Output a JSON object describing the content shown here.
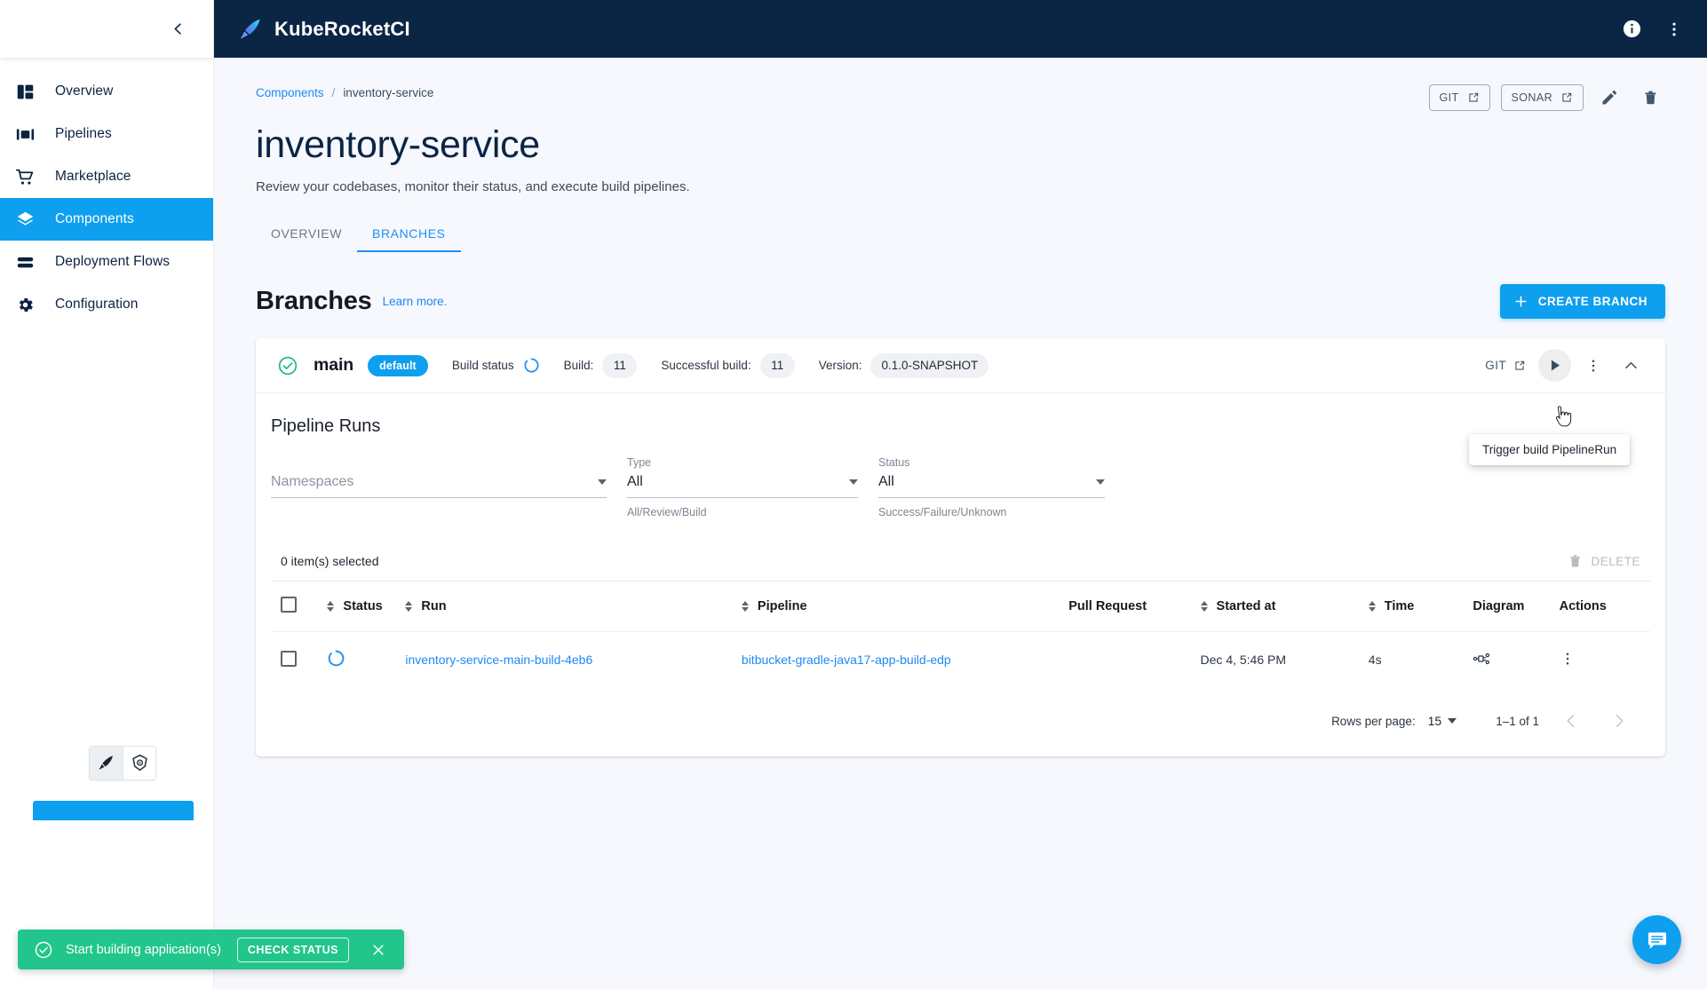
{
  "app": {
    "brand": "KubeRocketCI",
    "brand_logo_icon": "rocket-feather-icon",
    "info_icon": "info-icon",
    "overflow_icon": "vertical-dots-icon",
    "accent_color": "#0e9fef",
    "topbar_color": "#0b2545",
    "link_color": "#1e88f5",
    "success_color": "#22c58b"
  },
  "sidebar": {
    "collapse_icon": "chevron-left-icon",
    "items": [
      {
        "label": "Overview",
        "icon": "dashboard-icon",
        "active": false
      },
      {
        "label": "Pipelines",
        "icon": "pipelines-icon",
        "active": false
      },
      {
        "label": "Marketplace",
        "icon": "cart-icon",
        "active": false
      },
      {
        "label": "Components",
        "icon": "layers-icon",
        "active": true
      },
      {
        "label": "Deployment Flows",
        "icon": "stacked-bars-icon",
        "active": false
      },
      {
        "label": "Configuration",
        "icon": "gear-icon",
        "active": false
      }
    ],
    "fab_buttons": [
      {
        "icon": "rocket-feather-icon",
        "selected": true
      },
      {
        "icon": "kubernetes-icon",
        "selected": false
      }
    ]
  },
  "breadcrumb": {
    "parent": "Components",
    "separator": "/",
    "current": "inventory-service"
  },
  "header_actions": {
    "git_label": "GIT",
    "sonar_label": "SONAR",
    "external_link_icon": "external-link-icon",
    "edit_icon": "pencil-icon",
    "delete_icon": "trash-icon"
  },
  "page": {
    "title": "inventory-service",
    "subtitle": "Review your codebases, monitor their status, and execute build pipelines."
  },
  "tabs": [
    {
      "label": "OVERVIEW",
      "active": false
    },
    {
      "label": "BRANCHES",
      "active": true
    }
  ],
  "branches_section": {
    "title": "Branches",
    "learn_more": "Learn more.",
    "create_button": "CREATE BRANCH",
    "plus_icon": "plus-icon"
  },
  "branch": {
    "status_icon": "check-circle-icon",
    "name": "main",
    "badge": "default",
    "build_status_label": "Build status",
    "build_status_icon": "spinner-icon",
    "build_label": "Build:",
    "build_value": "11",
    "successful_build_label": "Successful build:",
    "successful_build_value": "11",
    "version_label": "Version:",
    "version_value": "0.1.0-SNAPSHOT",
    "git_label": "GIT",
    "git_icon": "external-link-icon",
    "play_icon": "play-icon",
    "menu_icon": "vertical-dots-icon",
    "collapse_icon": "chevron-up-icon",
    "tooltip": "Trigger build PipelineRun"
  },
  "pipeline_runs": {
    "title": "Pipeline Runs",
    "filters": [
      {
        "label": "",
        "value": "Namespaces",
        "is_placeholder": true,
        "help": ""
      },
      {
        "label": "Type",
        "value": "All",
        "is_placeholder": false,
        "help": "All/Review/Build"
      },
      {
        "label": "Status",
        "value": "All",
        "is_placeholder": false,
        "help": "Success/Failure/Unknown"
      }
    ],
    "selection_text": "0 item(s) selected",
    "delete_label": "DELETE",
    "delete_icon": "trash-icon",
    "columns": [
      {
        "label": "",
        "sortable": false,
        "key": "checkbox"
      },
      {
        "label": "Status",
        "sortable": true,
        "key": "status"
      },
      {
        "label": "Run",
        "sortable": true,
        "key": "run"
      },
      {
        "label": "Pipeline",
        "sortable": true,
        "key": "pipeline"
      },
      {
        "label": "Pull Request",
        "sortable": false,
        "key": "pr"
      },
      {
        "label": "Started at",
        "sortable": true,
        "key": "started"
      },
      {
        "label": "Time",
        "sortable": true,
        "key": "time"
      },
      {
        "label": "Diagram",
        "sortable": false,
        "key": "diagram"
      },
      {
        "label": "Actions",
        "sortable": false,
        "key": "actions"
      }
    ],
    "rows": [
      {
        "status_icon": "spinner-icon",
        "run": "inventory-service-main-build-4eb6",
        "pipeline": "bitbucket-gradle-java17-app-build-edp",
        "pull_request": "",
        "started_at": "Dec 4, 5:46 PM",
        "time": "4s",
        "diagram_icon": "diagram-icon",
        "actions_icon": "vertical-dots-icon"
      }
    ],
    "pagination": {
      "rows_per_page_label": "Rows per page:",
      "rows_per_page_value": "15",
      "range": "1–1 of 1",
      "prev_icon": "chevron-left-icon",
      "next_icon": "chevron-right-icon"
    }
  },
  "toast": {
    "icon": "check-circle-icon",
    "message": "Start building application(s)",
    "action": "CHECK STATUS",
    "close_icon": "close-icon"
  },
  "chat_fab": {
    "icon": "chat-icon"
  }
}
